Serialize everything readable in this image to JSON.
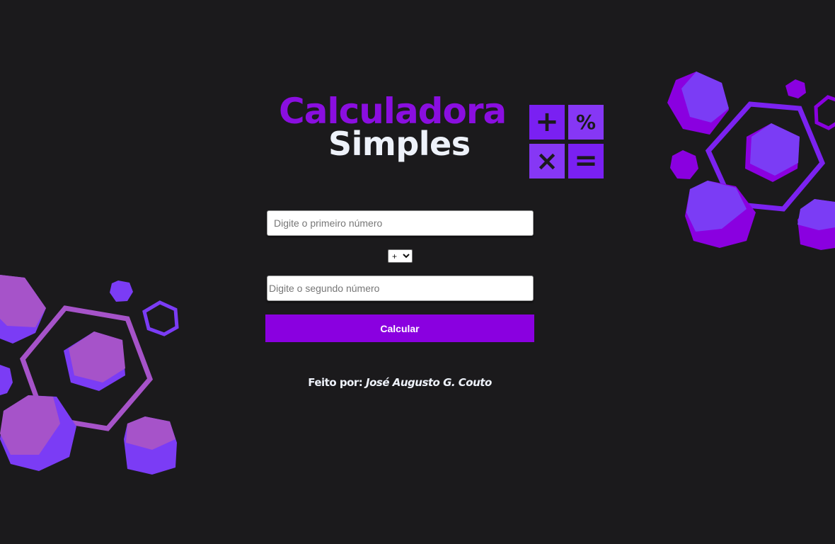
{
  "title": {
    "line1": "Calculadora",
    "line2": "Simples"
  },
  "logo": {
    "tiles": [
      {
        "symbol": "+",
        "icon": "plus-icon"
      },
      {
        "symbol": "%",
        "icon": "percent-icon"
      },
      {
        "symbol": "×",
        "icon": "times-icon"
      },
      {
        "symbol": "=",
        "icon": "equals-icon"
      }
    ]
  },
  "form": {
    "first_placeholder": "Digite o primeiro número",
    "first_value": "",
    "operator_selected": "+",
    "operator_options": [
      "+",
      "-",
      "*",
      "/"
    ],
    "second_placeholder": "Digite o segundo número",
    "second_value": "",
    "submit_label": "Calcular"
  },
  "footer": {
    "prefix": "Feito por: ",
    "author": "José Augusto G. Couto"
  },
  "colors": {
    "background": "#1b1a1c",
    "accent": "#8a00e0",
    "accent_light": "#8637f5",
    "hex_pink": "#a653c9",
    "text_light": "#eef2fa"
  }
}
